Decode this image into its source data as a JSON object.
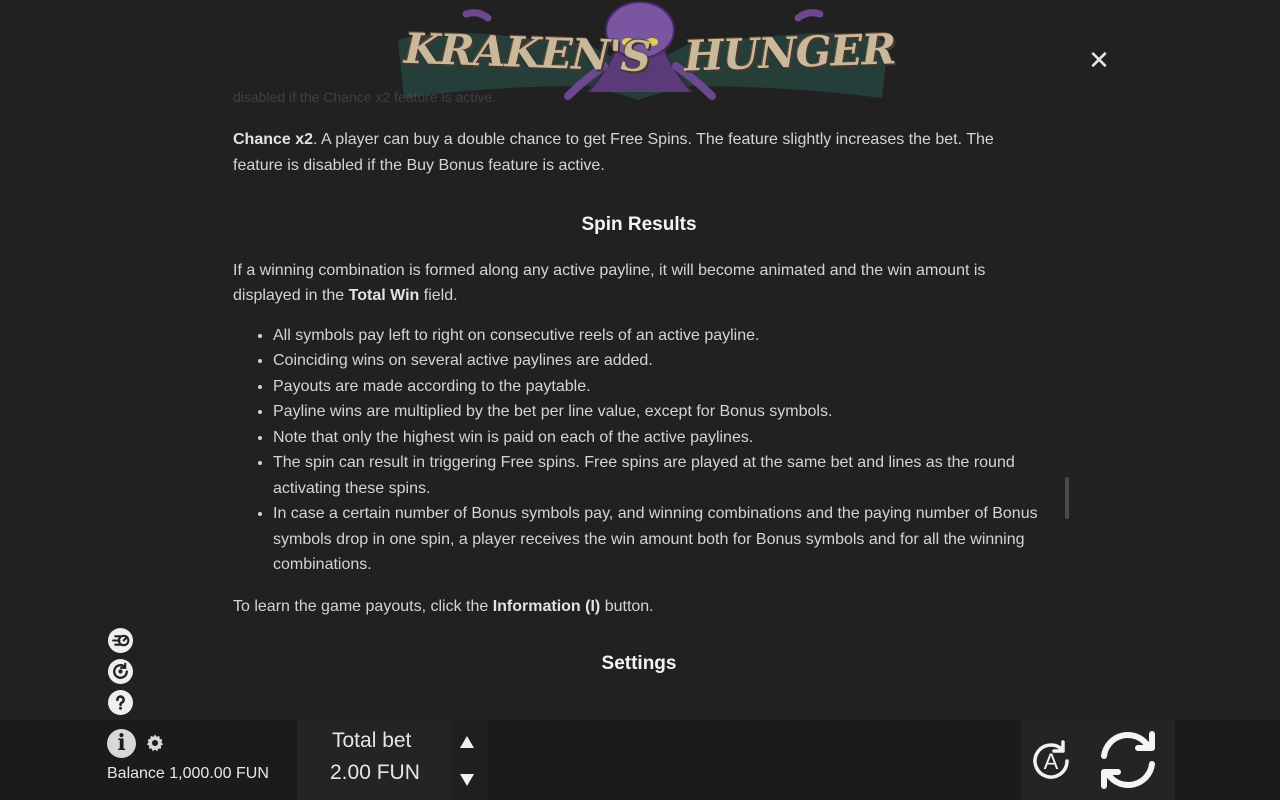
{
  "logo": {
    "left_word": "KRAKEN'S",
    "right_word": "HUNGER",
    "icon": "octopus-icon"
  },
  "close": {
    "icon": "close-icon",
    "glyph": "✕"
  },
  "content": {
    "faded_text": "disabled if the Chance x2 feature is active.",
    "chance_title": "Chance x2",
    "chance_text": ". A player can buy a double chance to get Free Spins. The feature slightly increases the bet. The feature is disabled if the Buy Bonus feature is active.",
    "spin_results_title": "Spin Results",
    "spin_intro_a": "If a winning combination is formed along any active payline, it will become animated and the win amount is displayed in the ",
    "spin_intro_bold": "Total Win",
    "spin_intro_b": " field.",
    "bullets": [
      "All symbols pay left to right on consecutive reels of an active payline.",
      "Coinciding wins on several active paylines are added.",
      "Payouts are made according to the paytable.",
      "Payline wins are multiplied by the bet per line value, except for Bonus symbols.",
      "Note that only the highest win is paid on each of the active paylines.",
      "The spin can result in triggering Free spins. Free spins are played at the same bet and lines as the round activating these spins.",
      "In case a certain number of Bonus symbols pay, and winning combinations and the paying number of Bonus symbols drop in one spin, a player receives the win amount both for Bonus symbols and for all the winning combinations."
    ],
    "learn_a": "To learn the game payouts, click the ",
    "learn_bold": "Information (I)",
    "learn_b": " button.",
    "settings_title": "Settings"
  },
  "side_icons": [
    "turbo-icon",
    "autoplay-history-icon",
    "help-icon"
  ],
  "bottom": {
    "info_glyph": "i",
    "balance_label": "Balance",
    "balance_value": "1,000.00 FUN",
    "total_bet_label": "Total bet",
    "total_bet_value": "2.00 FUN",
    "auto_label": "A"
  },
  "colors": {
    "background": "#212121",
    "bottom_bar": "#1b1b1b",
    "text": "#d4d4d4",
    "heading": "#f4f4f4"
  }
}
